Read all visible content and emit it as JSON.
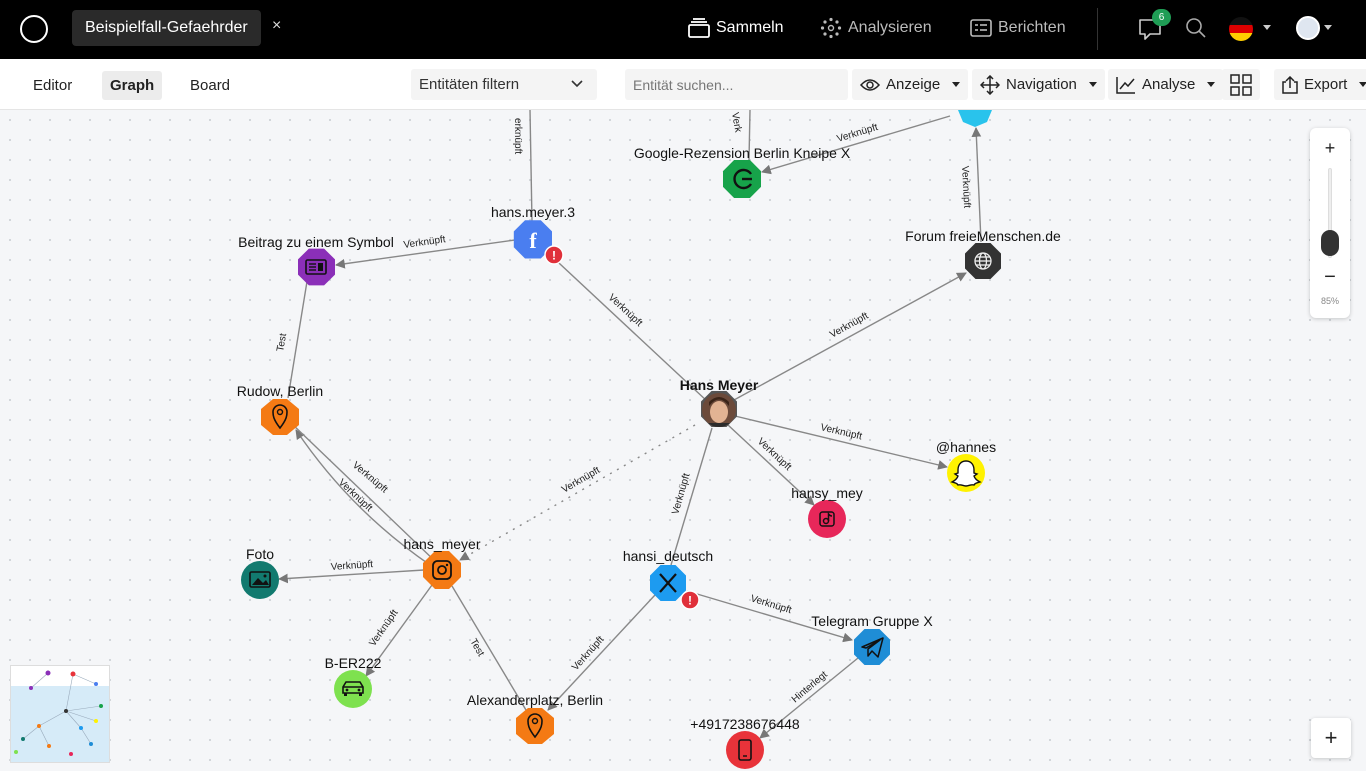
{
  "app": {
    "case_tab": "Beispielfall-Gefaehrder",
    "close_symbol": "×",
    "nav": {
      "sammeln": "Sammeln",
      "analysieren": "Analysieren",
      "berichten": "Berichten"
    },
    "notification_count": "6"
  },
  "toolbar": {
    "tabs": {
      "editor": "Editor",
      "graph": "Graph",
      "board": "Board"
    },
    "filter": "Entitäten filtern",
    "search_placeholder": "Entität suchen...",
    "anzeige": "Anzeige",
    "navigation": "Navigation",
    "analyse": "Analyse",
    "export": "Export"
  },
  "graph": {
    "nodes": {
      "hans_meyer": "Hans Meyer",
      "hans_meyer_3": "hans.meyer.3",
      "beitrag": "Beitrag zu einem Symbol",
      "google": "Google-Rezension Berlin Kneipe X",
      "forum": "Forum freieMenschen.de",
      "rudow": "Rudow, Berlin",
      "hannes": "@hannes",
      "hansy_mey": "hansy_mey",
      "hans_meyer_ig": "hans_meyer",
      "hansi_deutsch": "hansi_deutsch",
      "foto": "Foto",
      "telegram": "Telegram Gruppe X",
      "ber222": "B-ER222",
      "alexanderplatz": "Alexanderplatz, Berlin",
      "phone": "+4917238676448"
    },
    "edges": {
      "verknuepft": "Verknüpft",
      "test": "Test",
      "hinterlegt": "Hinterlegt",
      "partial_top": "erknüpft",
      "partial_verk": "Verk"
    },
    "colors": {
      "facebook": "#4a7ef0",
      "purple": "#8b2fb8",
      "google": "#17a34a",
      "dark": "#333333",
      "orange": "#f47a14",
      "snapchat": "#fff200",
      "pink": "#e7275a",
      "twitter": "#1d9bf0",
      "teal": "#127a6f",
      "telegram": "#1f8dd6",
      "lime": "#7ee14f",
      "red": "#e8333a"
    }
  },
  "zoom": {
    "plus": "+",
    "minus": "−",
    "level": "85%"
  },
  "add_symbol": "+"
}
